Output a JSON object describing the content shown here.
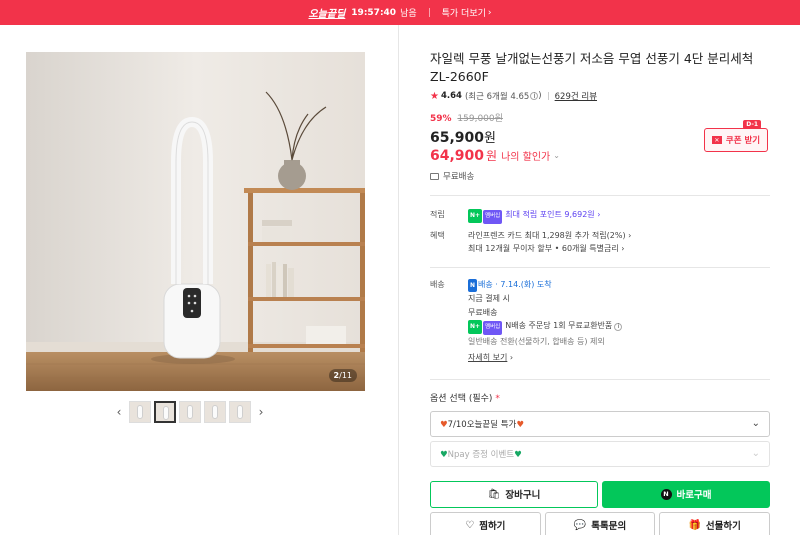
{
  "banner": {
    "brand": "오늘끝딜",
    "timer": "19:57:40",
    "remaining": "남음",
    "more_label": "특가 더보기",
    "more_chevron": "›"
  },
  "gallery": {
    "counter_current": "2",
    "counter_total": "/11",
    "prev_icon": "chevron-left-icon",
    "next_icon": "chevron-right-icon",
    "thumbnail_count": 5,
    "active_thumbnail": 2
  },
  "product": {
    "title": "자일렉 무풍 날개없는선풍기 저소음 무엽 선풍기 4단 분리세척 ZL-2660F",
    "rating": "4.64",
    "rating_recent": "(최근 6개월 4.65",
    "rating_recent_close": ")",
    "review_count": "629건 리뷰",
    "discount_pct": "59%",
    "original_price": "159,000원",
    "price": "65,900",
    "price_unit": "원",
    "my_price": "64,900",
    "my_price_unit": "원",
    "my_price_label": "나의 할인가",
    "coupon_label": "쿠폰 받기",
    "coupon_badge": "D-1",
    "free_shipping": "무료배송"
  },
  "benefits": {
    "points_key": "적립",
    "points_npay": "N+",
    "points_badge": "멤버십",
    "points_text": "최대 적립 포인트 9,692원",
    "benefit_key": "혜택",
    "benefit_line1": "라인프렌즈 카드 최대 1,298원 추가 적립(2%)",
    "benefit_line2": "최대 12개월 무이자 할부 • 60개월 특별금리"
  },
  "delivery": {
    "key": "배송",
    "nbadge": "N",
    "type": "배송 · 7.14.(화) 도착",
    "condition": "지금 결제 시",
    "fee": "무료배송",
    "return_npay": "N+",
    "return_badge": "멤버십",
    "return_text": "N배송 주문당 1회 무료교환반품",
    "exclude_text": "일반배송 전환(선물하기, 합배송 등) 제외",
    "detail_link": "자세히 보기"
  },
  "options": {
    "label": "옵션 선택 (필수)",
    "required_mark": "*",
    "select1": "7/10오늘끝딜 특가",
    "select2": "Npay 증정 이벤트"
  },
  "actions": {
    "cart": "장바구니",
    "buy": "바로구매",
    "buy_badge": "N",
    "wish": "찜하기",
    "talk": "톡톡문의",
    "gift": "선물하기"
  },
  "colors": {
    "accent_red": "#f2334a",
    "naver_green": "#03c75a",
    "point_violet": "#5b3ff1"
  }
}
